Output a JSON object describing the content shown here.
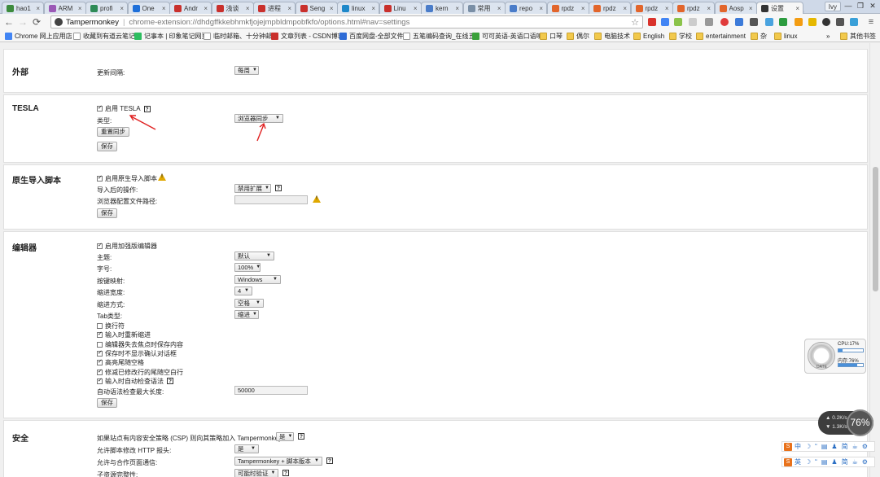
{
  "browser": {
    "tabs": [
      {
        "title": "hao1",
        "icon": "leaf-favicon",
        "color": "#3d8b3d"
      },
      {
        "title": "ARM",
        "icon": "arm-favicon",
        "color": "#9b59b6"
      },
      {
        "title": "profi",
        "icon": "profile-favicon",
        "color": "#2e8b57"
      },
      {
        "title": "One",
        "icon": "v-favicon",
        "color": "#1e6fd9"
      },
      {
        "title": "Andr",
        "icon": "csdn-favicon",
        "color": "#c9302c"
      },
      {
        "title": "浅谈",
        "icon": "csdn-favicon",
        "color": "#c9302c"
      },
      {
        "title": "进程",
        "icon": "csdn-favicon",
        "color": "#c9302c"
      },
      {
        "title": "Seng",
        "icon": "csdn-favicon",
        "color": "#c9302c"
      },
      {
        "title": "linux",
        "icon": "blog-favicon",
        "color": "#1e88c9"
      },
      {
        "title": "Linu",
        "icon": "csdn-favicon",
        "color": "#c9302c"
      },
      {
        "title": "kern",
        "icon": "blog-favicon",
        "color": "#4a7cc9"
      },
      {
        "title": "常用",
        "icon": "page-favicon",
        "color": "#7a8fa6"
      },
      {
        "title": "repo",
        "icon": "blog-favicon",
        "color": "#4a7cc9"
      },
      {
        "title": "rpdz",
        "icon": "gitlab-favicon",
        "color": "#e2652b"
      },
      {
        "title": "rpdz",
        "icon": "gitlab-favicon",
        "color": "#e2652b"
      },
      {
        "title": "rpdz",
        "icon": "gitlab-favicon",
        "color": "#e2652b"
      },
      {
        "title": "rpdz",
        "icon": "gitlab-favicon",
        "color": "#e2652b"
      },
      {
        "title": "Aosp",
        "icon": "gitlab-favicon",
        "color": "#e2652b"
      },
      {
        "title": "设置",
        "icon": "tampermonkey-favicon",
        "color": "#333333",
        "active": true
      }
    ],
    "profile": "Ivy",
    "window_controls": [
      "—",
      "❐",
      "✕"
    ],
    "omnibox": {
      "site": "Tampermonkey",
      "separator": "|",
      "url": "chrome-extension://dhdgffkkebhmkfjojejmpbldmpobfkfo/options.html#nav=settings"
    },
    "bookmarks": [
      {
        "label": "Chrome 网上应用店",
        "icon": "apps-icon"
      },
      {
        "label": "收藏到有道云笔记",
        "icon": "page-icon"
      },
      {
        "label": "记事本 | 印象笔记网页",
        "icon": "evernote-icon"
      },
      {
        "label": "临时邮箱、十分钟邮箱",
        "icon": "page-icon"
      },
      {
        "label": "文章列表 - CSDN博客",
        "icon": "csdn-icon"
      },
      {
        "label": "百度网盘-全部文件",
        "icon": "baidu-icon"
      },
      {
        "label": "五笔编码查询_在线五",
        "icon": "page-icon"
      },
      {
        "label": "可可英语-英语口语听",
        "icon": "kekenet-icon"
      },
      {
        "label": "口琴",
        "icon": "folder-icon"
      },
      {
        "label": "偶尔",
        "icon": "folder-icon"
      },
      {
        "label": "电脑技术",
        "icon": "folder-icon"
      },
      {
        "label": "English",
        "icon": "folder-icon"
      },
      {
        "label": "学校",
        "icon": "folder-icon"
      },
      {
        "label": "entertainment",
        "icon": "folder-icon"
      },
      {
        "label": "杂",
        "icon": "folder-icon"
      },
      {
        "label": "linux",
        "icon": "folder-icon"
      }
    ],
    "bookmarks_overflow": "»",
    "other_bookmarks": "其他书签"
  },
  "settings": {
    "external": {
      "title": "外部",
      "update_interval_label": "更新间隔:",
      "update_interval_value": "每周"
    },
    "tesla": {
      "title": "TESLA",
      "enable_label": "启用 TESLA",
      "enable_checked": true,
      "type_label": "类型:",
      "type_value": "浏览器同步",
      "reset_button": "重置同步",
      "save_button": "保存"
    },
    "native_import": {
      "title": "原生导入脚本",
      "enable_label": "启用原生导入脚本",
      "enable_checked": true,
      "after_import_label": "导入后的操作:",
      "after_import_value": "禁用扩展",
      "profile_path_label": "浏览器配置文件路径:",
      "profile_path_value": "",
      "save_button": "保存"
    },
    "editor": {
      "title": "编辑器",
      "enhanced_label": "启用加强版编辑器",
      "enhanced_checked": true,
      "theme_label": "主题:",
      "theme_value": "默认",
      "font_size_label": "字号:",
      "font_size_value": "100%",
      "keymap_label": "按键映射:",
      "keymap_value": "Windows",
      "indent_width_label": "缩进宽度:",
      "indent_width_value": "4",
      "indent_with_label": "缩进方式:",
      "indent_with_value": "空格",
      "tab_type_label": "Tab类型:",
      "tab_type_value": "缩进",
      "options": [
        {
          "label": "换行符",
          "checked": false
        },
        {
          "label": "输入时重新缩进",
          "checked": true
        },
        {
          "label": "编辑器失去焦点时保存内容",
          "checked": false
        },
        {
          "label": "保存时不显示确认对话框",
          "checked": true
        },
        {
          "label": "高亮尾随空格",
          "checked": true
        },
        {
          "label": "修减已修改行的尾随空白行",
          "checked": true
        },
        {
          "label": "输入时自动检查语法",
          "checked": true
        }
      ],
      "autolint_max_label": "自动语法检查最大长度:",
      "autolint_max_value": "50000",
      "save_button": "保存"
    },
    "security": {
      "title": "安全",
      "csp_label": "如果站点有内容安全策略 (CSP) 则向其策略加入 Tampermonkey:",
      "csp_value": "是",
      "http_headers_label": "允许脚本修改 HTTP 报头:",
      "http_headers_value": "是",
      "communication_label": "允许与合作页面通信:",
      "communication_value": "Tampermonkey + 脚本版本",
      "sri_label": "子资源完整性:",
      "sri_value": "可能时验证"
    },
    "help_glyph": "?"
  },
  "overlays": {
    "monitor": {
      "cpu_label": "CPU:17%",
      "cpu_percent": 17,
      "mem_label": "内存:76%",
      "mem_percent": 76,
      "gauge_caption": "DATE"
    },
    "network": {
      "up": "0.2K/s",
      "down": "1.3K/s",
      "percent": "76%"
    },
    "ime": [
      {
        "items": [
          "中",
          "☽",
          "“",
          "▤",
          "♟",
          "简",
          "☕",
          "⚙"
        ]
      },
      {
        "items": [
          "英",
          "☽",
          "“",
          "▤",
          "♟",
          "简",
          "☕",
          "⚙"
        ]
      }
    ]
  }
}
